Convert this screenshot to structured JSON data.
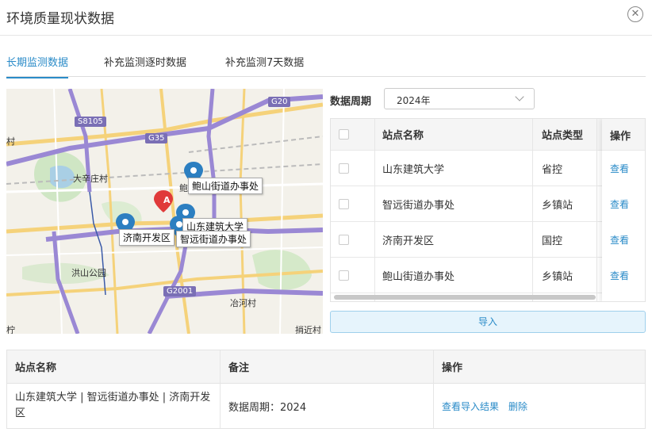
{
  "header": {
    "title": "环境质量现状数据"
  },
  "tabs": [
    {
      "label": "长期监测数据"
    },
    {
      "label": "补充监测逐时数据"
    },
    {
      "label": "补充监测7天数据"
    }
  ],
  "map": {
    "road_labels": [
      "S8105",
      "G35",
      "G20",
      "G2001"
    ],
    "place_labels": [
      "大辛庄村",
      "洪山公园",
      "冶河村",
      "捎近村",
      "村",
      "柠",
      "鲍"
    ],
    "markers": [
      "鲍山街道办事处",
      "山东建筑大学",
      "智远街道办事处",
      "济南开发区"
    ],
    "pin_a": "A"
  },
  "filter": {
    "label": "数据周期",
    "value": "2024年"
  },
  "station_table": {
    "columns": [
      "站点名称",
      "站点类型",
      "操作"
    ],
    "rows": [
      {
        "name": "山东建筑大学",
        "type": "省控",
        "action": "查看"
      },
      {
        "name": "智远街道办事处",
        "type": "乡镇站",
        "action": "查看"
      },
      {
        "name": "济南开发区",
        "type": "国控",
        "action": "查看"
      },
      {
        "name": "鲍山街道办事处",
        "type": "乡镇站",
        "action": "查看"
      }
    ]
  },
  "import_button": "导入",
  "result_table": {
    "columns": [
      "站点名称",
      "备注",
      "操作"
    ],
    "rows": [
      {
        "name": "山东建筑大学 | 智远街道办事处 | 济南开发区",
        "note": "数据周期：2024",
        "actions": [
          "查看导入结果",
          "删除"
        ]
      }
    ]
  },
  "colors": {
    "accent": "#2a8bc8",
    "highway": "#9a88d4",
    "pin_blue": "#2c7fc1",
    "pin_red": "#e03a3a"
  },
  "icons": {
    "close": "close-circle-icon",
    "dropdown": "chevron-down-icon",
    "marker": "map-pin-icon",
    "park": "tree-icon"
  }
}
